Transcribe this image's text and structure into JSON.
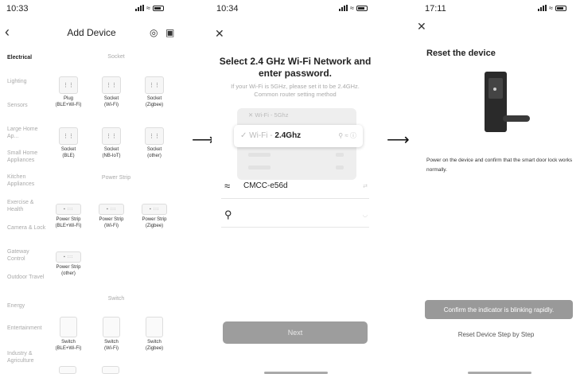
{
  "screen1": {
    "time": "10:33",
    "title": "Add Device",
    "sidebar": [
      "Electrical",
      "Lighting",
      "Sensors",
      "Large Home Ap...",
      "Small Home Appliances",
      "Kitchen Appliances",
      "Exercise & Health",
      "Camera & Lock",
      "Gateway Control",
      "Outdoor Travel",
      "Energy",
      "Entertainment",
      "Industry & Agriculture"
    ],
    "sections": {
      "socket": "Socket",
      "power_strip": "Power Strip",
      "switch": "Switch"
    },
    "devices": {
      "socket": [
        "Plug\n(BLE+Wi-Fi)",
        "Socket\n(Wi-Fi)",
        "Socket\n(Zigbee)",
        "Socket\n(BLE)",
        "Socket\n(NB-IoT)",
        "Socket\n(other)"
      ],
      "power_strip": [
        "Power Strip\n(BLE+Wi-Fi)",
        "Power Strip\n(Wi-Fi)",
        "Power Strip\n(Zigbee)",
        "Power Strip\n(other)"
      ],
      "switch": [
        "Switch\n(BLE+Wi-Fi)",
        "Switch\n(Wi-Fi)",
        "Switch\n(Zigbee)"
      ]
    }
  },
  "screen2": {
    "time": "10:34",
    "heading_line1": "Select 2.4 GHz Wi-Fi Network and",
    "heading_line2": "enter password.",
    "sub_line1": "If your Wi-Fi is 5GHz, please set it to be 2.4GHz.",
    "sub_line2": "Common router setting method",
    "wifi_5g_prefix": "Wi-Fi - ",
    "wifi_5g_band": "5Ghz",
    "wifi_24_prefix": "Wi-Fi - ",
    "wifi_24_band": "2.4Ghz",
    "ssid": "CMCC-e56d",
    "password_placeholder": "",
    "next_label": "Next"
  },
  "screen3": {
    "time": "17:11",
    "title": "Reset the device",
    "description": "Power on the device and confirm that the smart door lock works normally.",
    "confirm_label": "Confirm the indicator is blinking rapidly.",
    "step_link": "Reset Device Step by Step"
  }
}
